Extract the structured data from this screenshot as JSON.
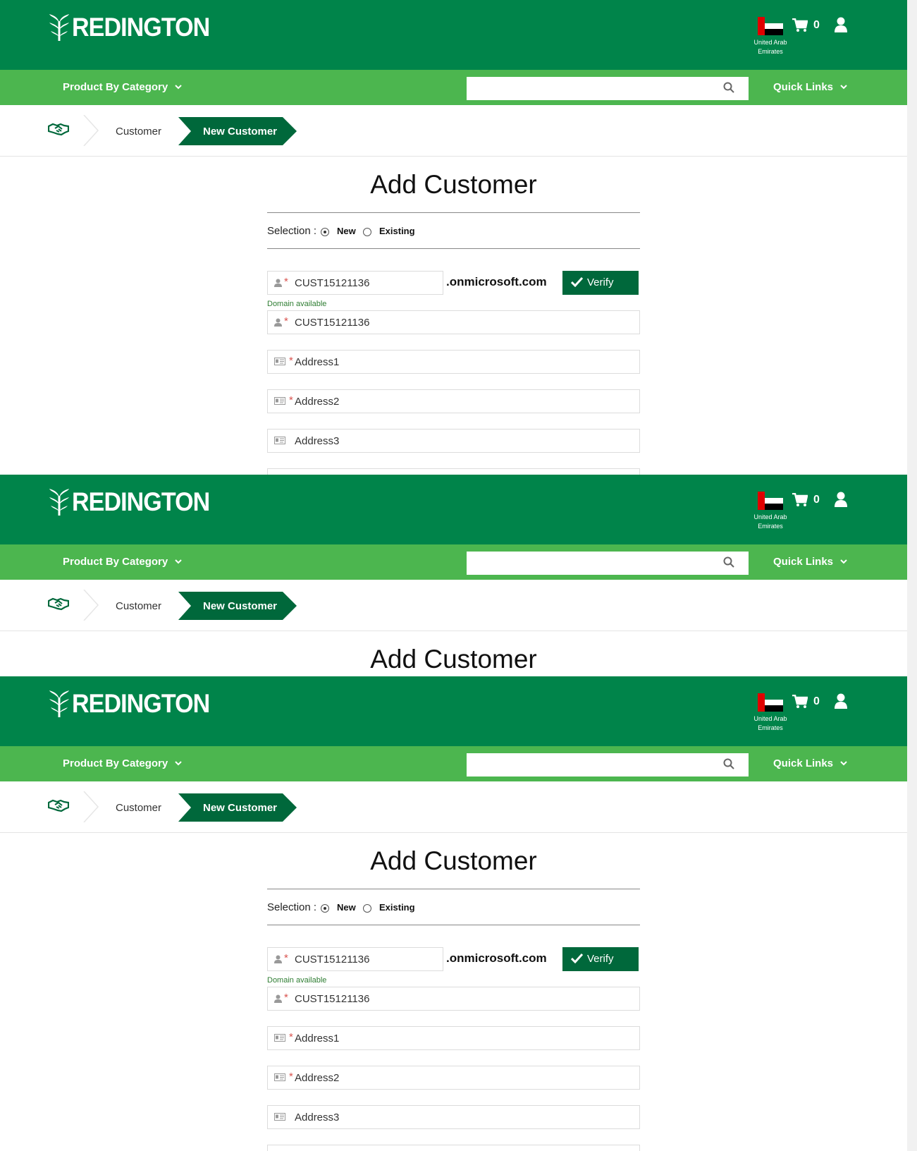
{
  "header": {
    "logo_text": "REDINGTON",
    "country": {
      "line1": "United Arab",
      "line2": "Emirates"
    },
    "cart_count": "0"
  },
  "nav": {
    "category_label": "Product By Category",
    "search_placeholder": "",
    "quick_links_label": "Quick Links"
  },
  "breadcrumb": {
    "customer": "Customer",
    "current": "New Customer"
  },
  "page": {
    "title": "Add Customer"
  },
  "form": {
    "selection_label": "Selection :",
    "options": [
      {
        "label": "New",
        "selected": true
      },
      {
        "label": "Existing",
        "selected": false
      }
    ],
    "domain_value": "CUST15121136",
    "domain_suffix": ".onmicrosoft.com",
    "verify_label": "Verify",
    "domain_status": "Domain available",
    "company_value": "CUST15121136",
    "address1_placeholder": "Address1",
    "address2_placeholder": "Address2",
    "address3_placeholder": "Address3",
    "required_mark": "*"
  },
  "colors": {
    "header_green": "#00844a",
    "nav_green": "#4cb64f",
    "breadcrumb_active": "#00683b",
    "required_red": "#d9534f"
  }
}
